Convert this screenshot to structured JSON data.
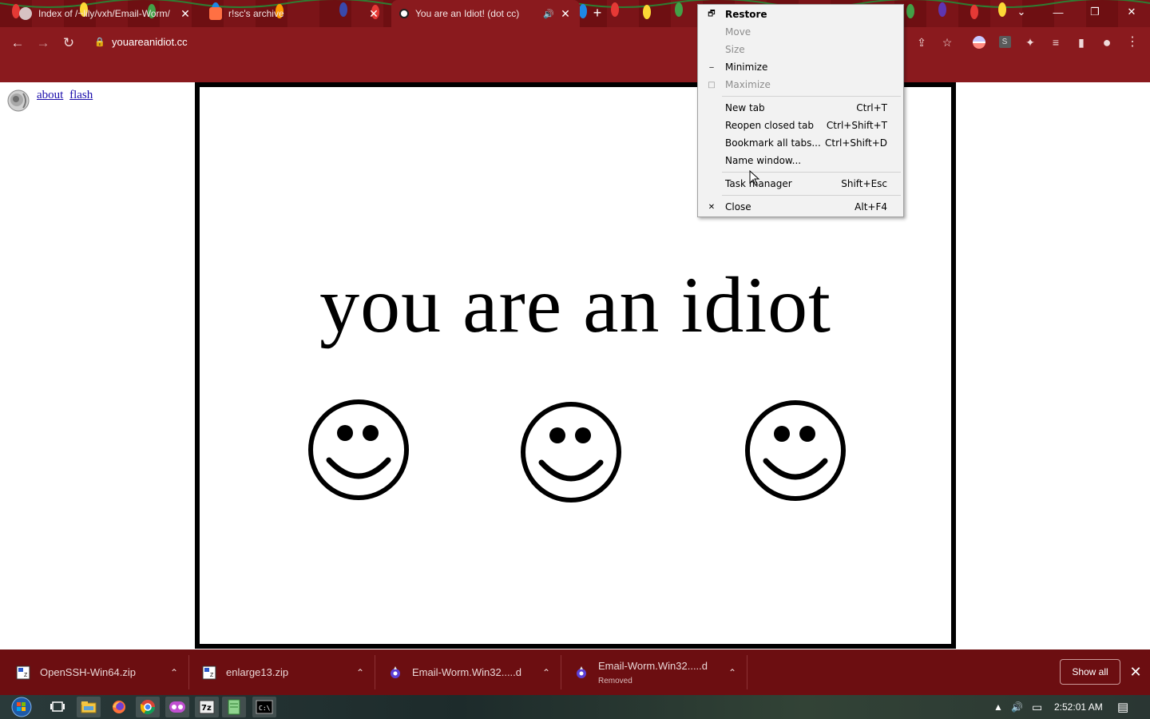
{
  "tabs": [
    {
      "title": "Index of /~lily/vxh/Email-Worm/",
      "close": "✕"
    },
    {
      "title": "r!sc's archive",
      "close": "✕"
    },
    {
      "title": "You are an Idiot! (dot cc)",
      "close": "✕",
      "audio": "🔊"
    }
  ],
  "newtab": "+",
  "window_controls": {
    "dropdown": "⌄",
    "minimize": "—",
    "restore": "❐",
    "close": "✕"
  },
  "toolbar": {
    "back": "←",
    "forward": "→",
    "reload": "↻",
    "lock": "🔒",
    "url": "youareanidiot.cc",
    "share": "⇪",
    "bookmark": "☆",
    "ext_s": "S",
    "extensions": "✦",
    "readlist": "≡",
    "sidepanel": "▮",
    "profile": "●",
    "menu": "⋮"
  },
  "page": {
    "links": [
      "about",
      "flash"
    ],
    "headline": "you are an idiot",
    "smiley_count": 3
  },
  "context_menu": {
    "items": [
      {
        "label": "Restore",
        "icon": "🗗",
        "shortcut": "",
        "disabled": false,
        "bold": true
      },
      {
        "label": "Move",
        "icon": "",
        "shortcut": "",
        "disabled": true
      },
      {
        "label": "Size",
        "icon": "",
        "shortcut": "",
        "disabled": true
      },
      {
        "label": "Minimize",
        "icon": "‒",
        "shortcut": "",
        "disabled": false
      },
      {
        "label": "Maximize",
        "icon": "□",
        "shortcut": "",
        "disabled": true
      },
      {
        "label": "New tab",
        "icon": "",
        "shortcut": "Ctrl+T",
        "disabled": false
      },
      {
        "label": "Reopen closed tab",
        "icon": "",
        "shortcut": "Ctrl+Shift+T",
        "disabled": false
      },
      {
        "label": "Bookmark all tabs...",
        "icon": "",
        "shortcut": "Ctrl+Shift+D",
        "disabled": false
      },
      {
        "label": "Name window...",
        "icon": "",
        "shortcut": "",
        "disabled": false
      },
      {
        "label": "Task manager",
        "icon": "",
        "shortcut": "Shift+Esc",
        "disabled": false
      },
      {
        "label": "Close",
        "icon": "✕",
        "shortcut": "Alt+F4",
        "disabled": false
      }
    ]
  },
  "downloads": [
    {
      "name": "OpenSSH-Win64.zip",
      "sub": "",
      "chevron": "⌃"
    },
    {
      "name": "enlarge13.zip",
      "sub": "",
      "chevron": "⌃"
    },
    {
      "name": "Email-Worm.Win32.....d",
      "sub": "",
      "chevron": "⌃"
    },
    {
      "name": "Email-Worm.Win32.....d",
      "sub": "Removed",
      "chevron": "⌃"
    }
  ],
  "shelf": {
    "show_all": "Show all",
    "close": "✕"
  },
  "taskbar": {
    "clock": "2:52:01 AM",
    "tray_arrow": "▲",
    "volume": "🔊",
    "network": "▭",
    "notifications": "▤"
  }
}
